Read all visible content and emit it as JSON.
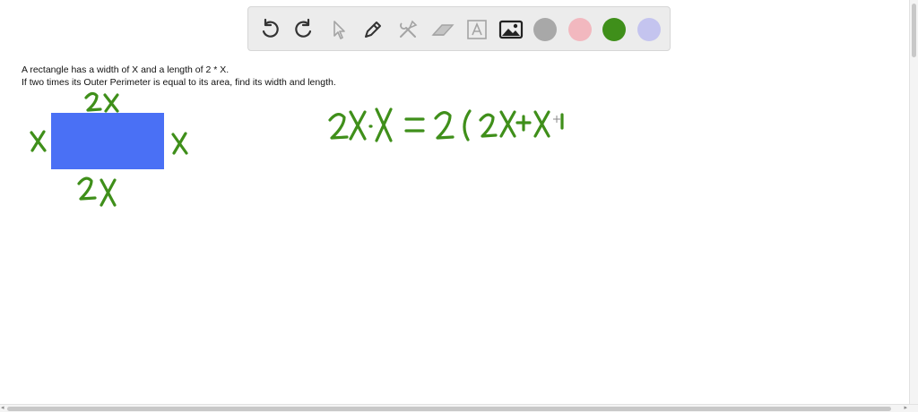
{
  "toolbar": {
    "tools": [
      {
        "icon": "undo-icon"
      },
      {
        "icon": "redo-icon"
      },
      {
        "icon": "pointer-icon",
        "disabled": true
      },
      {
        "icon": "pen-icon"
      },
      {
        "icon": "tools-icon",
        "disabled": true
      },
      {
        "icon": "eraser-icon",
        "disabled": true
      },
      {
        "icon": "text-icon",
        "disabled": true
      },
      {
        "icon": "image-icon"
      }
    ],
    "colors": [
      "#a8a8a8",
      "#f2b8bf",
      "#3f8f1a",
      "#c4c4ef"
    ],
    "selected_color": "#3f8f1a"
  },
  "problem": {
    "line1": "A rectangle has a width of X and a length of 2 * X.",
    "line2": "If two times its Outer Perimeter is equal to its area, find its width and length."
  },
  "diagram": {
    "rect_color": "#4a70f5",
    "ink_color": "#3f8f1a"
  },
  "scrollbars": {
    "left_arrow": "◂",
    "right_arrow": "▸"
  }
}
